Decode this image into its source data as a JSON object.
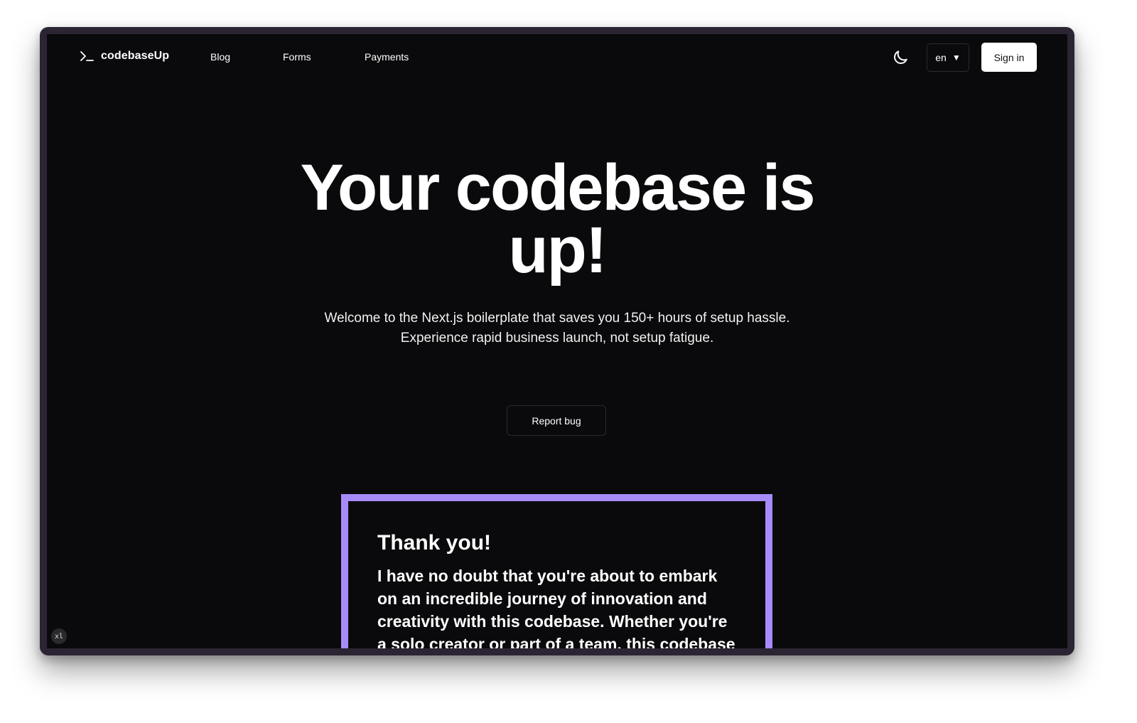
{
  "nav": {
    "brand": "codebaseUp",
    "brand_icon": "terminal-prompt-icon",
    "links": [
      "Blog",
      "Forms",
      "Payments"
    ],
    "theme_icon": "moon-icon",
    "language": "en",
    "language_arrow": "▼",
    "signin_label": "Sign in"
  },
  "hero": {
    "title_line1": "Your codebase is",
    "title_line2": "up!",
    "subtitle_line1": "Welcome to the Next.js boilerplate that saves you 150+ hours of setup hassle.",
    "subtitle_line2": "Experience rapid business launch, not setup fatigue.",
    "report_bug_label": "Report bug"
  },
  "card": {
    "title": "Thank you!",
    "body": "I have no doubt that you're about to embark on an incredible journey of innovation and creativity with this codebase. Whether you're a solo creator or part of a team, this codebase"
  },
  "breakpoint_badge": "xl",
  "colors": {
    "background": "#0a0a0c",
    "accent_border": "#a78bfa",
    "frame": "#2b2533",
    "button_primary_bg": "#ffffff"
  }
}
